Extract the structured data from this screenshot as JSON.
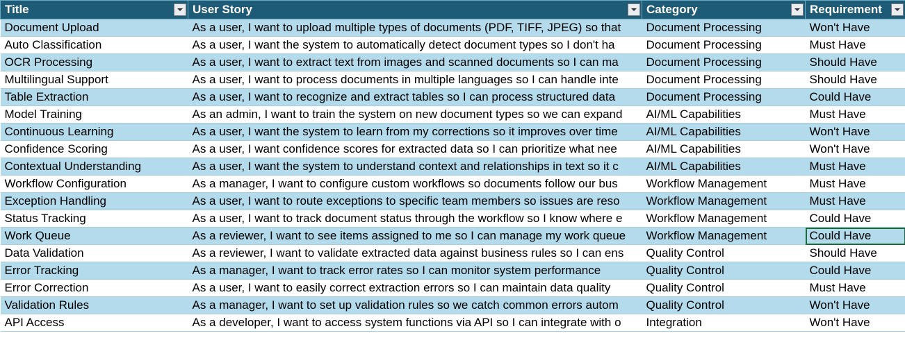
{
  "headers": {
    "title": "Title",
    "story": "User Story",
    "category": "Category",
    "requirement": "Requirement"
  },
  "rows": [
    {
      "title": "Document Upload",
      "story": "As a user, I want to upload multiple types of documents (PDF, TIFF, JPEG) so that",
      "category": "Document Processing",
      "requirement": "Won't Have"
    },
    {
      "title": "Auto Classification",
      "story": "As a user, I want the system to automatically detect document types so I don't ha",
      "category": "Document Processing",
      "requirement": "Must Have"
    },
    {
      "title": "OCR Processing",
      "story": "As a user, I want to extract text from images and scanned documents so I can ma",
      "category": "Document Processing",
      "requirement": "Should Have"
    },
    {
      "title": "Multilingual Support",
      "story": "As a user, I want to process documents in multiple languages so I can handle inte",
      "category": "Document Processing",
      "requirement": "Should Have"
    },
    {
      "title": "Table Extraction",
      "story": "As a user, I want to recognize and extract tables so I can process structured data",
      "category": "Document Processing",
      "requirement": "Could Have"
    },
    {
      "title": "Model Training",
      "story": "As an admin, I want to train the system on new document types so we can expand",
      "category": "AI/ML Capabilities",
      "requirement": "Must Have"
    },
    {
      "title": "Continuous Learning",
      "story": "As a user, I want the system to learn from my corrections so it improves over time",
      "category": "AI/ML Capabilities",
      "requirement": "Won't Have"
    },
    {
      "title": "Confidence Scoring",
      "story": "As a user, I want confidence scores for extracted data so I can prioritize what nee",
      "category": "AI/ML Capabilities",
      "requirement": "Won't Have"
    },
    {
      "title": "Contextual Understanding",
      "story": "As a user, I want the system to understand context and relationships in text so it c",
      "category": "AI/ML Capabilities",
      "requirement": "Must Have"
    },
    {
      "title": "Workflow Configuration",
      "story": "As a manager, I want to configure custom workflows so documents follow our bus",
      "category": "Workflow Management",
      "requirement": "Must Have"
    },
    {
      "title": "Exception Handling",
      "story": "As a user, I want to route exceptions to specific team members so issues are reso",
      "category": "Workflow Management",
      "requirement": "Must Have"
    },
    {
      "title": "Status Tracking",
      "story": "As a user, I want to track document status through the workflow so I know where e",
      "category": "Workflow Management",
      "requirement": "Could Have"
    },
    {
      "title": "Work Queue",
      "story": "As a reviewer, I want to see items assigned to me so I can manage my work queue",
      "category": "Workflow Management",
      "requirement": "Could Have",
      "selected": true
    },
    {
      "title": "Data Validation",
      "story": "As a reviewer, I want to validate extracted data against business rules so I can ens",
      "category": "Quality Control",
      "requirement": "Should Have"
    },
    {
      "title": "Error Tracking",
      "story": "As a manager, I want to track error rates so I can monitor system performance",
      "category": "Quality Control",
      "requirement": "Could Have"
    },
    {
      "title": "Error Correction",
      "story": "As a user, I want to easily correct extraction errors so I can maintain data quality",
      "category": "Quality Control",
      "requirement": "Must Have"
    },
    {
      "title": "Validation Rules",
      "story": "As a manager, I want to set up validation rules so we catch common errors autom",
      "category": "Quality Control",
      "requirement": "Won't Have"
    },
    {
      "title": "API Access",
      "story": "As a developer, I want to access system functions via API so I can integrate with o",
      "category": "Integration",
      "requirement": "Won't Have"
    }
  ]
}
